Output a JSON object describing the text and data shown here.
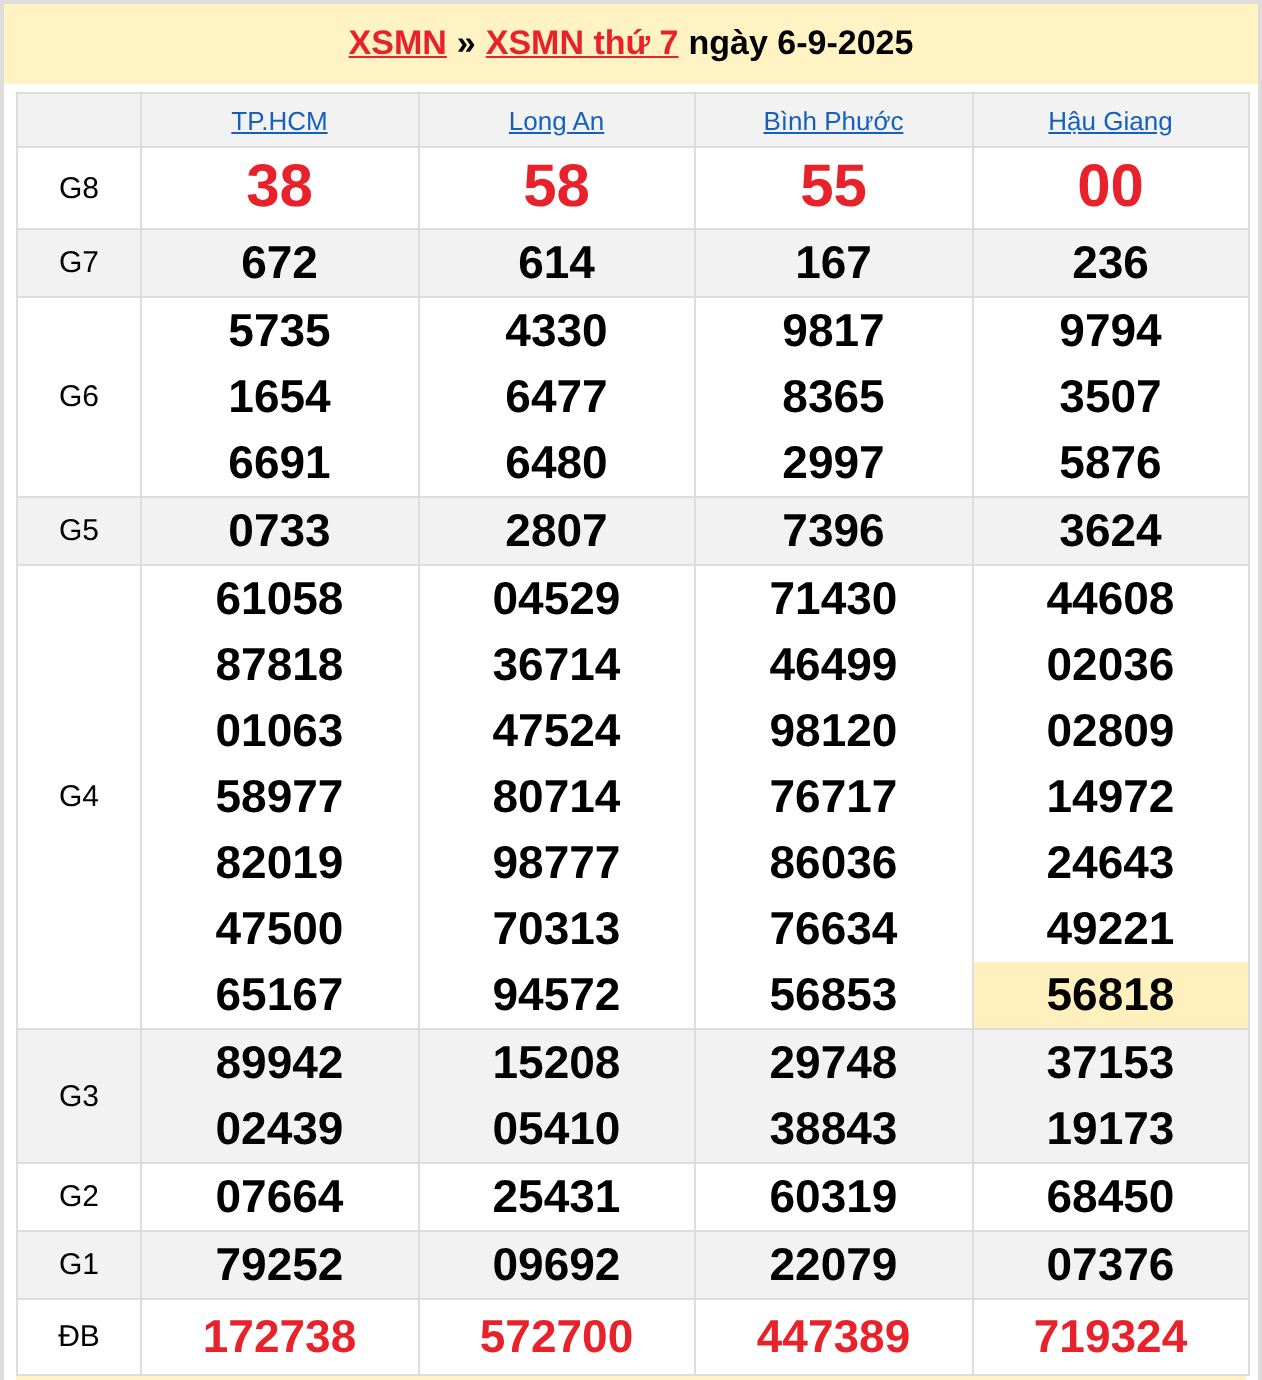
{
  "title": {
    "links": [
      "XSMN",
      "XSMN thứ 7"
    ],
    "separator": "»",
    "date": "ngày 6-9-2025"
  },
  "provinces": [
    "TP.HCM",
    "Long An",
    "Bình Phước",
    "Hậu Giang"
  ],
  "prizes": [
    {
      "label": "G8",
      "kind": "top",
      "cells": [
        [
          {
            "v": "38",
            "hl": false
          }
        ],
        [
          {
            "v": "58",
            "hl": false
          }
        ],
        [
          {
            "v": "55",
            "hl": false
          }
        ],
        [
          {
            "v": "00",
            "hl": false
          }
        ]
      ]
    },
    {
      "label": "G7",
      "kind": "normal",
      "cells": [
        [
          {
            "v": "672",
            "hl": false
          }
        ],
        [
          {
            "v": "614",
            "hl": false
          }
        ],
        [
          {
            "v": "167",
            "hl": false
          }
        ],
        [
          {
            "v": "236",
            "hl": false
          }
        ]
      ]
    },
    {
      "label": "G6",
      "kind": "normal",
      "cells": [
        [
          {
            "v": "5735",
            "hl": false
          },
          {
            "v": "1654",
            "hl": false
          },
          {
            "v": "6691",
            "hl": false
          }
        ],
        [
          {
            "v": "4330",
            "hl": false
          },
          {
            "v": "6477",
            "hl": false
          },
          {
            "v": "6480",
            "hl": false
          }
        ],
        [
          {
            "v": "9817",
            "hl": false
          },
          {
            "v": "8365",
            "hl": false
          },
          {
            "v": "2997",
            "hl": false
          }
        ],
        [
          {
            "v": "9794",
            "hl": false
          },
          {
            "v": "3507",
            "hl": false
          },
          {
            "v": "5876",
            "hl": false
          }
        ]
      ]
    },
    {
      "label": "G5",
      "kind": "normal",
      "cells": [
        [
          {
            "v": "0733",
            "hl": false
          }
        ],
        [
          {
            "v": "2807",
            "hl": false
          }
        ],
        [
          {
            "v": "7396",
            "hl": false
          }
        ],
        [
          {
            "v": "3624",
            "hl": false
          }
        ]
      ]
    },
    {
      "label": "G4",
      "kind": "normal",
      "cells": [
        [
          {
            "v": "61058",
            "hl": false
          },
          {
            "v": "87818",
            "hl": false
          },
          {
            "v": "01063",
            "hl": false
          },
          {
            "v": "58977",
            "hl": false
          },
          {
            "v": "82019",
            "hl": false
          },
          {
            "v": "47500",
            "hl": false
          },
          {
            "v": "65167",
            "hl": false
          }
        ],
        [
          {
            "v": "04529",
            "hl": false
          },
          {
            "v": "36714",
            "hl": false
          },
          {
            "v": "47524",
            "hl": false
          },
          {
            "v": "80714",
            "hl": false
          },
          {
            "v": "98777",
            "hl": false
          },
          {
            "v": "70313",
            "hl": false
          },
          {
            "v": "94572",
            "hl": false
          }
        ],
        [
          {
            "v": "71430",
            "hl": false
          },
          {
            "v": "46499",
            "hl": false
          },
          {
            "v": "98120",
            "hl": false
          },
          {
            "v": "76717",
            "hl": false
          },
          {
            "v": "86036",
            "hl": false
          },
          {
            "v": "76634",
            "hl": false
          },
          {
            "v": "56853",
            "hl": false
          }
        ],
        [
          {
            "v": "44608",
            "hl": false
          },
          {
            "v": "02036",
            "hl": false
          },
          {
            "v": "02809",
            "hl": false
          },
          {
            "v": "14972",
            "hl": false
          },
          {
            "v": "24643",
            "hl": false
          },
          {
            "v": "49221",
            "hl": false
          },
          {
            "v": "56818",
            "hl": true
          }
        ]
      ]
    },
    {
      "label": "G3",
      "kind": "normal",
      "cells": [
        [
          {
            "v": "89942",
            "hl": false
          },
          {
            "v": "02439",
            "hl": false
          }
        ],
        [
          {
            "v": "15208",
            "hl": false
          },
          {
            "v": "05410",
            "hl": false
          }
        ],
        [
          {
            "v": "29748",
            "hl": false
          },
          {
            "v": "38843",
            "hl": false
          }
        ],
        [
          {
            "v": "37153",
            "hl": false
          },
          {
            "v": "19173",
            "hl": false
          }
        ]
      ]
    },
    {
      "label": "G2",
      "kind": "normal",
      "cells": [
        [
          {
            "v": "07664",
            "hl": false
          }
        ],
        [
          {
            "v": "25431",
            "hl": false
          }
        ],
        [
          {
            "v": "60319",
            "hl": false
          }
        ],
        [
          {
            "v": "68450",
            "hl": false
          }
        ]
      ]
    },
    {
      "label": "G1",
      "kind": "normal",
      "cells": [
        [
          {
            "v": "79252",
            "hl": false
          }
        ],
        [
          {
            "v": "09692",
            "hl": false
          }
        ],
        [
          {
            "v": "22079",
            "hl": false
          }
        ],
        [
          {
            "v": "07376",
            "hl": false
          }
        ]
      ]
    },
    {
      "label": "ĐB",
      "kind": "special",
      "cells": [
        [
          {
            "v": "172738",
            "hl": false
          }
        ],
        [
          {
            "v": "572700",
            "hl": false
          }
        ],
        [
          {
            "v": "447389",
            "hl": false
          }
        ],
        [
          {
            "v": "719324",
            "hl": false
          }
        ]
      ]
    }
  ]
}
